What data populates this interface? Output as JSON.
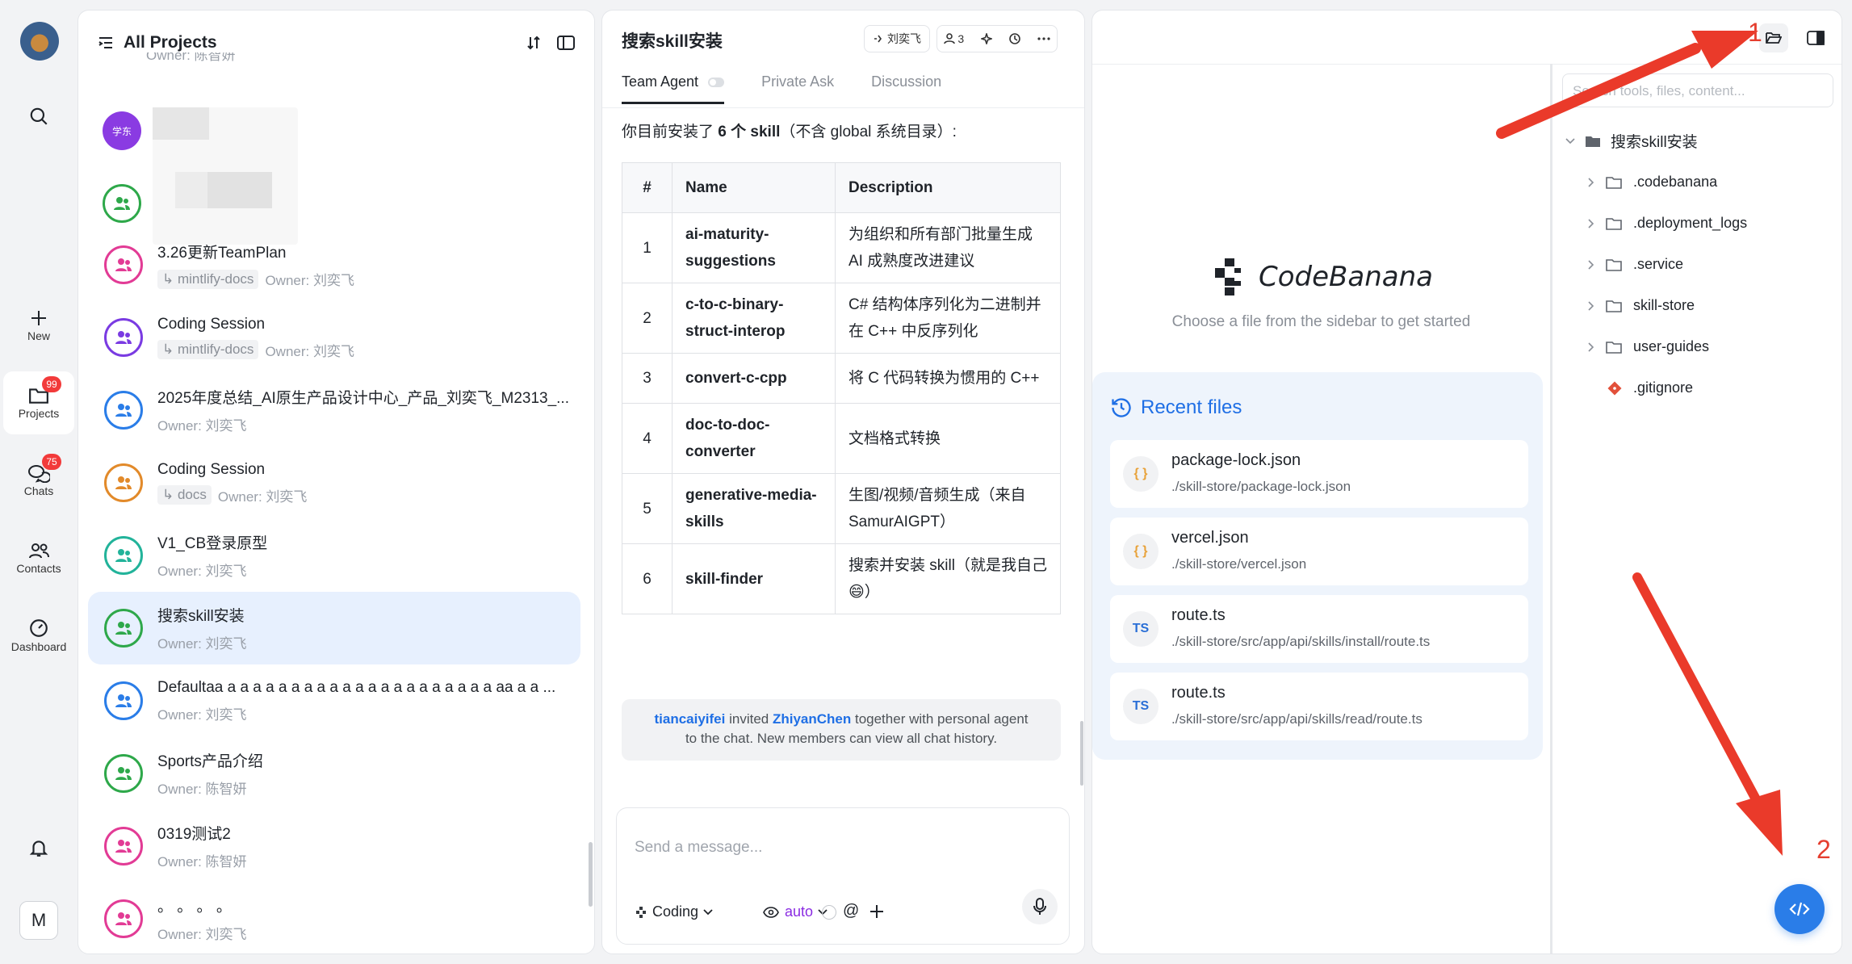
{
  "rail": {
    "new_label": "New",
    "projects_label": "Projects",
    "projects_badge": "99",
    "chats_label": "Chats",
    "chats_badge": "75",
    "contacts_label": "Contacts",
    "dashboard_label": "Dashboard",
    "user_initial": "M"
  },
  "projects_panel": {
    "title": "All Projects",
    "top_partial_sub": "Owner: 陈智妍",
    "blurred_avatar_text": "学东",
    "items": [
      {
        "name": "3.26更新TeamPlan",
        "tag": "mintlify-docs",
        "owner": "Owner: 刘奕飞",
        "color": "#e23b95"
      },
      {
        "name": "Coding Session",
        "tag": "mintlify-docs",
        "owner": "Owner: 刘奕飞",
        "color": "#7a3be2"
      },
      {
        "name": "2025年度总结_AI原生产品设计中心_产品_刘奕飞_M2313_...",
        "tag": "",
        "owner": "Owner: 刘奕飞",
        "color": "#2a7de8"
      },
      {
        "name": "Coding Session",
        "tag": "docs",
        "owner": "Owner: 刘奕飞",
        "color": "#e28a2a"
      },
      {
        "name": "V1_CB登录原型",
        "tag": "",
        "owner": "Owner: 刘奕飞",
        "color": "#22b39a"
      },
      {
        "name": "搜索skill安装",
        "tag": "",
        "owner": "Owner: 刘奕飞",
        "color": "#2ea84a"
      },
      {
        "name": "Defaultaa a a a a a a a a a a a a a a a a a a a a a aa a a ...",
        "tag": "",
        "owner": "Owner: 刘奕飞",
        "color": "#2a7de8"
      },
      {
        "name": "Sports产品介绍",
        "tag": "",
        "owner": "Owner: 陈智妍",
        "color": "#2ea84a"
      },
      {
        "name": "0319测试2",
        "tag": "",
        "owner": "Owner: 陈智妍",
        "color": "#e23b95"
      },
      {
        "name": "。 。 。 。",
        "tag": "",
        "owner": "Owner: 刘奕飞",
        "color": "#e23b95"
      }
    ]
  },
  "chat": {
    "title": "搜索skill安装",
    "owner_chip": "刘奕飞",
    "members_count": "3",
    "tabs": [
      "Team Agent",
      "Private Ask",
      "Discussion"
    ],
    "intro_pre": "你目前安装了 ",
    "intro_bold": "6 个 skill",
    "intro_post": "（不含 global 系统目录）:",
    "table_headers": [
      "#",
      "Name",
      "Description"
    ],
    "rows": [
      {
        "num": "1",
        "name": "ai-maturity-suggestions",
        "desc": "为组织和所有部门批量生成 AI 成熟度改进建议"
      },
      {
        "num": "2",
        "name": "c-to-c-binary-struct-interop",
        "desc": "C# 结构体序列化为二进制并在 C++ 中反序列化"
      },
      {
        "num": "3",
        "name": "convert-c-cpp",
        "desc": "将 C 代码转换为惯用的 C++"
      },
      {
        "num": "4",
        "name": "doc-to-doc-converter",
        "desc": "文档格式转换"
      },
      {
        "num": "5",
        "name": "generative-media-skills",
        "desc": "生图/视频/音频生成（来自 SamurAIGPT）"
      },
      {
        "num": "6",
        "name": "skill-finder",
        "desc": "搜索并安装 skill（就是我自己 😄）"
      }
    ],
    "system_message": {
      "user1": "tiancaiyifei",
      "mid1": " invited ",
      "user2": "ZhiyanChen",
      "rest": " together with personal agent",
      "line2": "to the chat. New members can view all chat history."
    },
    "composer_placeholder": "Send a message...",
    "mode_label": "Coding",
    "model_label": "auto"
  },
  "code_panel": {
    "brand": "CodeBanana",
    "choose_text": "Choose a file from the sidebar to get started",
    "recent_title": "Recent files",
    "recent_files": [
      {
        "icon": "{ }",
        "name": "package-lock.json",
        "path": "./skill-store/package-lock.json"
      },
      {
        "icon": "{ }",
        "name": "vercel.json",
        "path": "./skill-store/vercel.json"
      },
      {
        "icon": "TS",
        "name": "route.ts",
        "path": "./skill-store/src/app/api/skills/install/route.ts"
      },
      {
        "icon": "TS",
        "name": "route.ts",
        "path": "./skill-store/src/app/api/skills/read/route.ts"
      }
    ],
    "search_placeholder": "Search tools, files, content...",
    "root": "搜索skill安装",
    "tree": [
      ".codebanana",
      ".deployment_logs",
      ".service",
      "skill-store",
      "user-guides"
    ],
    "gitignore": ".gitignore"
  },
  "annotations": {
    "one": "1",
    "two": "2"
  }
}
